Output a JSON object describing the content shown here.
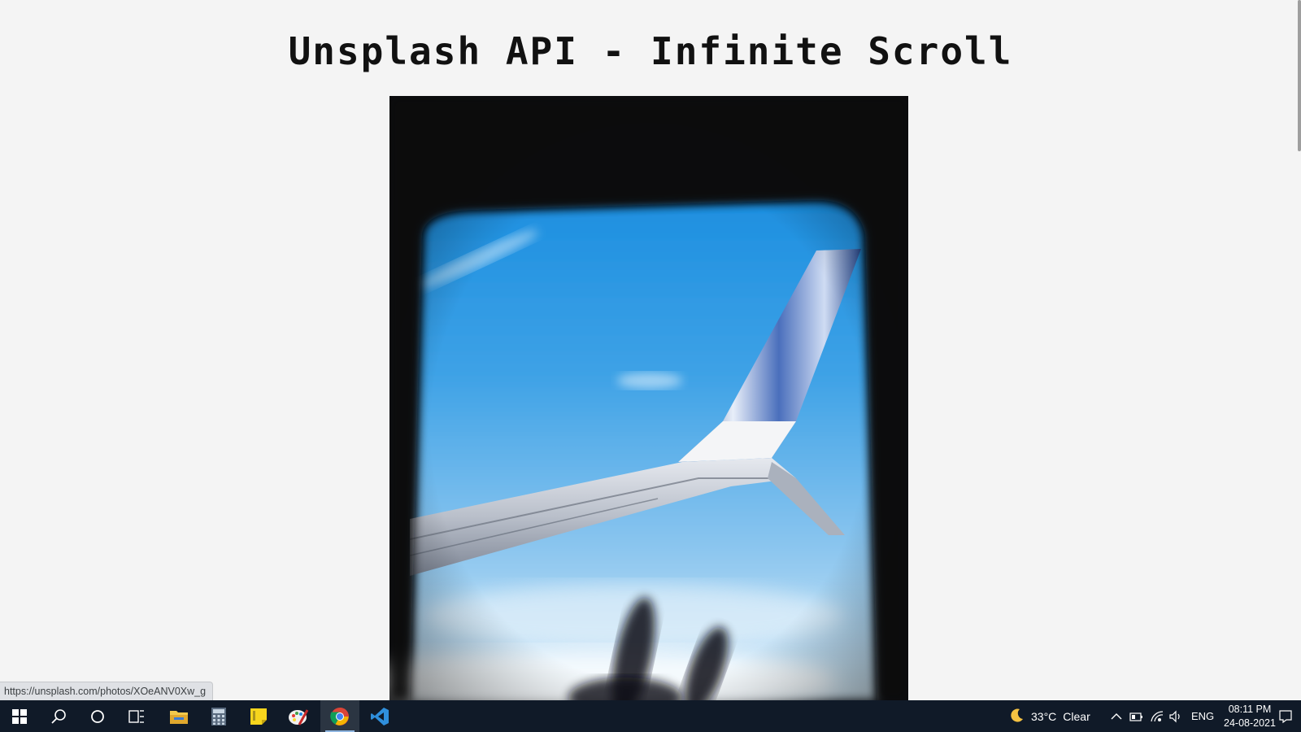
{
  "page": {
    "title": "Unsplash API - Infinite Scroll",
    "status_url": "https://unsplash.com/photos/XOeANV0Xw_g"
  },
  "photo": {
    "subject": "airplane-wing-through-window"
  },
  "taskbar": {
    "icons": [
      "windows-start-icon",
      "search-icon",
      "cortana-icon",
      "task-view-icon",
      "file-explorer-icon",
      "calculator-icon",
      "sticky-notes-icon",
      "paint-icon",
      "chrome-icon",
      "vscode-icon"
    ],
    "weather": {
      "icon": "moon-icon",
      "temp": "33°C",
      "condition": "Clear"
    },
    "language": "ENG",
    "time": "08:11 PM",
    "date": "24-08-2021"
  },
  "colors": {
    "taskbar_bg": "#101a28",
    "page_bg": "#f4f4f4",
    "chrome_active": "#2b3542"
  }
}
